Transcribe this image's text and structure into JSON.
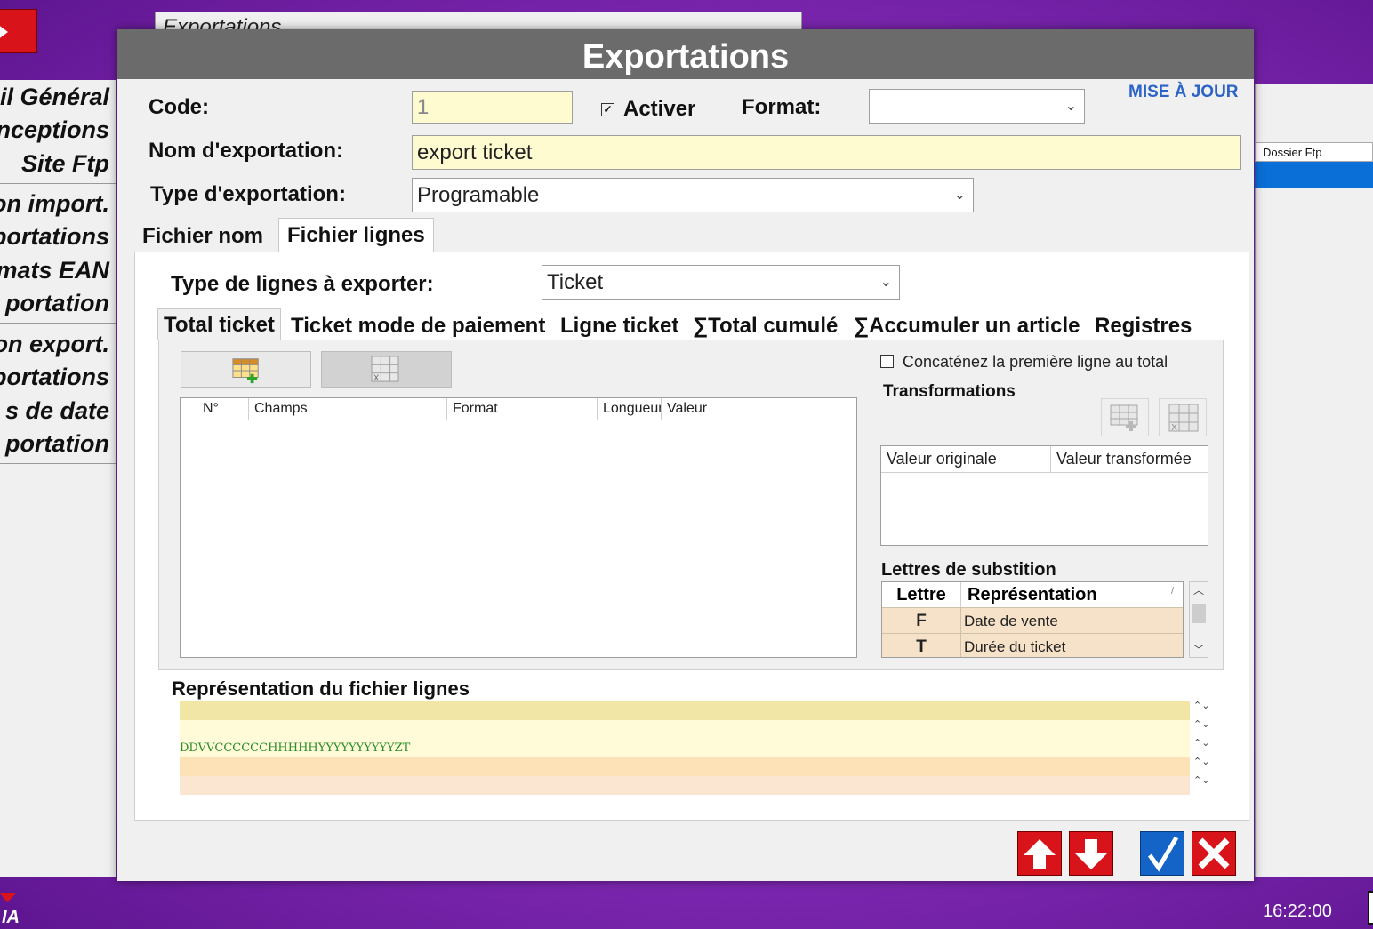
{
  "background": {
    "window_title": "Exportations",
    "menu_items": [
      "il Général",
      "nceptions",
      "Site Ftp",
      "on import.",
      "portations",
      "mats EAN",
      "portation",
      "on export.",
      "portations",
      "s de date",
      "portation"
    ],
    "right_panel_header": "Dossier Ftp",
    "clock": "16:22:00",
    "logo_text": "IA"
  },
  "dialog": {
    "title": "Exportations",
    "update_link": "MISE À JOUR",
    "code_label": "Code:",
    "code_value": "1",
    "activer_label": "Activer",
    "activer_checked": true,
    "format_label": "Format:",
    "format_value": "",
    "name_label": "Nom d'exportation:",
    "name_value": "export ticket",
    "type_label": "Type d'exportation:",
    "type_value": "Programable",
    "tabs": [
      "Fichier nom",
      "Fichier lignes"
    ],
    "active_tab": "Fichier lignes",
    "lines_type_label": "Type de lignes à exporter:",
    "lines_type_value": "Ticket",
    "sub_tabs": [
      "Total ticket",
      "Ticket mode de paiement",
      "Ligne ticket",
      "∑Total cumulé",
      "∑Accumuler un article",
      "Registres"
    ],
    "active_sub_tab": "Total ticket",
    "fields_table": {
      "columns": [
        "N°",
        "Champs",
        "Format",
        "Longueur",
        "Valeur"
      ],
      "rows": []
    },
    "concat_label": "Concaténez la première ligne au total",
    "concat_checked": false,
    "transformations_title": "Transformations",
    "transformations_columns": [
      "Valeur originale",
      "Valeur transformée"
    ],
    "substitution_title": "Lettres de substition",
    "substitution_columns": [
      "Lettre",
      "Représentation"
    ],
    "substitution_rows": [
      {
        "letter": "F",
        "representation": "Date de vente"
      },
      {
        "letter": "T",
        "representation": "Durée du ticket"
      }
    ],
    "representation_title": "Représentation du fichier lignes",
    "representation_lines": [
      "",
      "",
      "DDVVCCCCCCHHHHHYYYYYYYYYYZT",
      "",
      ""
    ],
    "representation_colors": [
      "#f2e6a6",
      "#fffbd8",
      "#fffbd8",
      "#fde2b8",
      "#fbe6d2"
    ]
  },
  "colors": {
    "accent_red": "#d8141a",
    "accent_blue": "#1464c8",
    "input_yellow": "#fffbd0",
    "link_blue": "#2c63c6"
  }
}
